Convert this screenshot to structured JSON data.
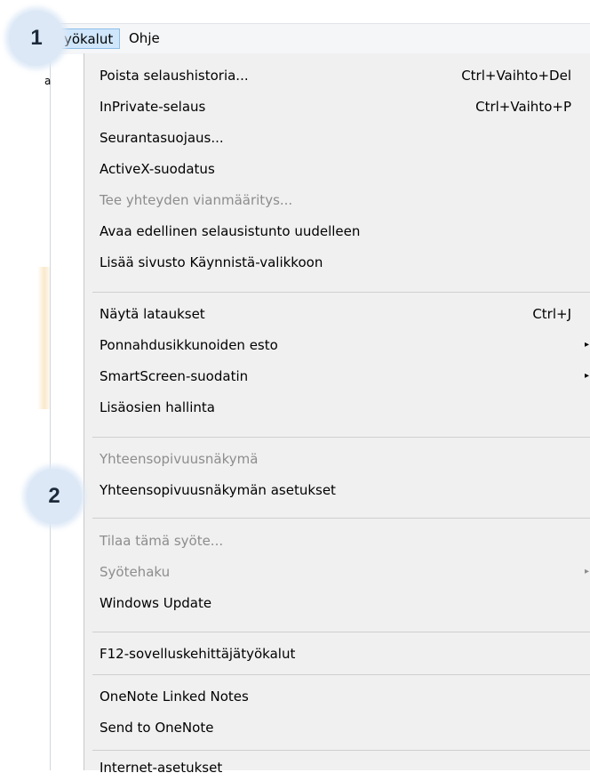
{
  "menubar": {
    "tools_label": "Työkalut",
    "tools_visible_text": "yökalut",
    "help_label": "Ohje"
  },
  "left_fragment": "a",
  "badges": {
    "one": "1",
    "two": "2"
  },
  "menu": {
    "items": [
      {
        "label": "Poista selaushistoria...",
        "shortcut": "Ctrl+Vaihto+Del",
        "enabled": true
      },
      {
        "label": "InPrivate-selaus",
        "shortcut": "Ctrl+Vaihto+P",
        "enabled": true
      },
      {
        "label": "Seurantasuojaus...",
        "enabled": true
      },
      {
        "label": "ActiveX-suodatus",
        "enabled": true
      },
      {
        "label": "Tee yhteyden vianmääritys...",
        "enabled": false
      },
      {
        "label": "Avaa edellinen selausistunto uudelleen",
        "enabled": true
      },
      {
        "label": "Lisää sivusto Käynnistä-valikkoon",
        "enabled": true
      },
      {
        "label": "Näytä lataukset",
        "shortcut": "Ctrl+J",
        "enabled": true
      },
      {
        "label": "Ponnahdusikkunoiden esto",
        "submenu": true,
        "enabled": true
      },
      {
        "label": "SmartScreen-suodatin",
        "submenu": true,
        "enabled": true
      },
      {
        "label": "Lisäosien hallinta",
        "enabled": true
      },
      {
        "label": "Yhteensopivuusnäkymä",
        "enabled": false
      },
      {
        "label": "Yhteensopivuusnäkymän asetukset",
        "enabled": true
      },
      {
        "label": "Tilaa tämä syöte...",
        "enabled": false
      },
      {
        "label": "Syötehaku",
        "submenu": true,
        "enabled": false
      },
      {
        "label": "Windows Update",
        "enabled": true
      },
      {
        "label": "F12-sovelluskehittäjätyökalut",
        "enabled": true
      },
      {
        "label": "OneNote Linked Notes",
        "enabled": true
      },
      {
        "label": "Send to OneNote",
        "enabled": true
      },
      {
        "label": "Internet-asetukset",
        "enabled": true
      }
    ],
    "submenu_arrow": "▸"
  },
  "colors": {
    "menu_bg": "#f0f0f0",
    "disabled_text": "#8d8d8d",
    "highlight_bg": "#cfe6fb",
    "highlight_border": "#8fbfe8",
    "badge_bg": "#dce8f6"
  }
}
